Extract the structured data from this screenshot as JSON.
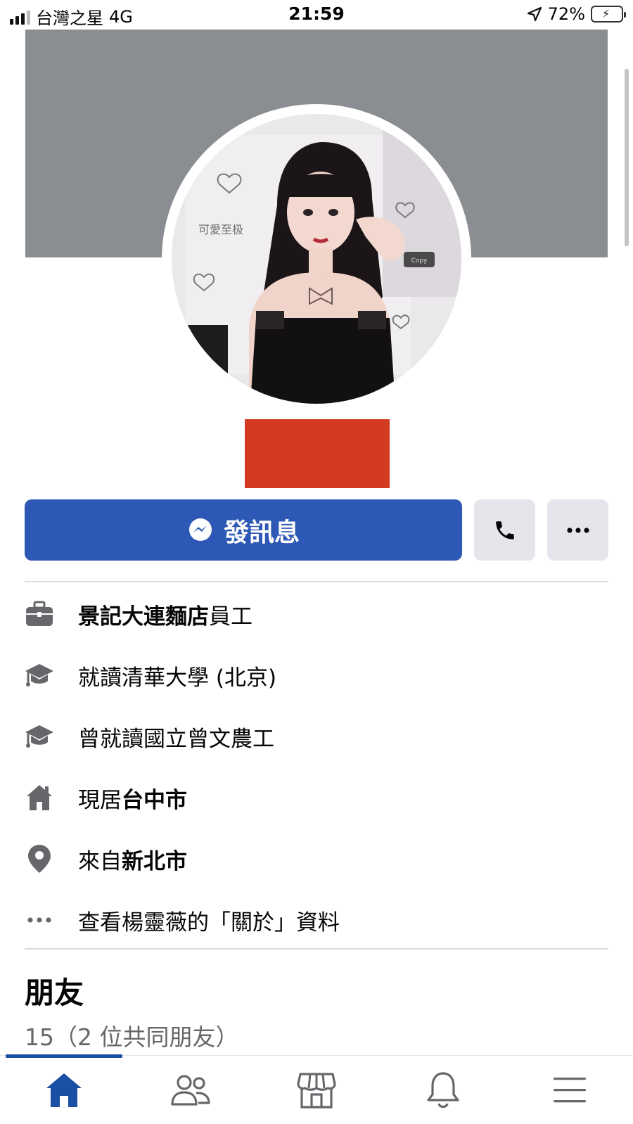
{
  "status_bar": {
    "carrier": "台灣之星",
    "network": "4G",
    "time": "21:59",
    "battery": "72%",
    "battery_level": 0.72
  },
  "profile": {
    "message_button": "發訊息",
    "details": [
      {
        "icon": "briefcase-icon",
        "plain_prefix": "",
        "bold": "景記大連麵店",
        "plain": "員工"
      },
      {
        "icon": "graduation-cap-icon",
        "plain_prefix": "就讀",
        "bold": "",
        "plain": "清華大學 (北京)"
      },
      {
        "icon": "graduation-cap-icon",
        "plain_prefix": "曾就讀",
        "bold": "",
        "plain": "國立曾文農工"
      },
      {
        "icon": "home-icon",
        "plain_prefix": "現居",
        "bold": "台中市",
        "plain": ""
      },
      {
        "icon": "location-pin-icon",
        "plain_prefix": "來自",
        "bold": "新北市",
        "plain": ""
      },
      {
        "icon": "more-dots-icon",
        "plain_prefix": "查看楊靈薇的「關於」資料",
        "bold": "",
        "plain": ""
      }
    ],
    "avatar_text": {
      "caption": "可愛至极",
      "badge": "Copy"
    }
  },
  "friends": {
    "title": "朋友",
    "count": "15（2 位共同朋友）"
  },
  "colors": {
    "cover": "#8a8d91",
    "primary": "#2e58b5",
    "redaction": "#d23a22",
    "nav_active": "#1b4ea5"
  },
  "bottom_nav": {
    "items": [
      "home-icon",
      "friends-icon",
      "marketplace-icon",
      "notifications-icon",
      "menu-icon"
    ],
    "active": 0
  }
}
